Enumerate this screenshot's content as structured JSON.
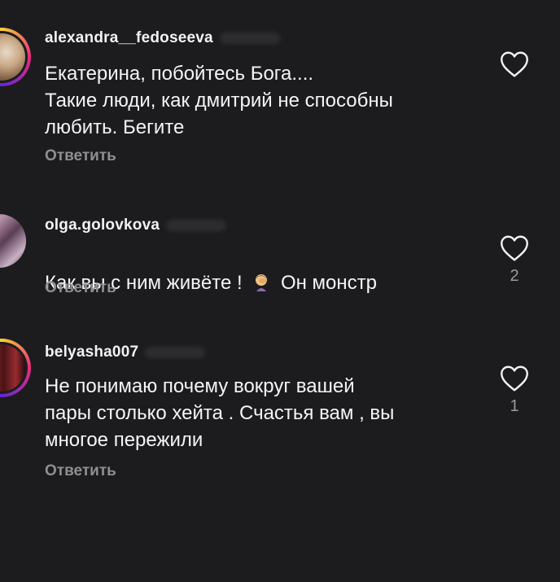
{
  "comments": [
    {
      "username": "alexandra__fedoseeva",
      "text": "Екатерина, побойтесь Бога....\nТакие люди, как дмитрий не способны\nлюбить. Бегите",
      "reply_label": "Ответить",
      "likes": ""
    },
    {
      "username": "olga.golovkova",
      "text_before": "Как вы с ним живёте ! ",
      "text_after": " Он монстр",
      "emoji": "face-palm-emoji",
      "reply_label": "Ответить",
      "likes": "2"
    },
    {
      "username": "belyasha007",
      "text": "Не понимаю почему вокруг вашей\nпары столько хейта . Счастья вам , вы\nмногое пережили",
      "reply_label": "Ответить",
      "likes": "1"
    }
  ],
  "icons": {
    "like": "heart-outline-icon"
  },
  "colors": {
    "background": "#1c1c1f",
    "text": "#f5f5f5",
    "muted": "#8e8e93",
    "story_ring": "#ee2a7b"
  }
}
